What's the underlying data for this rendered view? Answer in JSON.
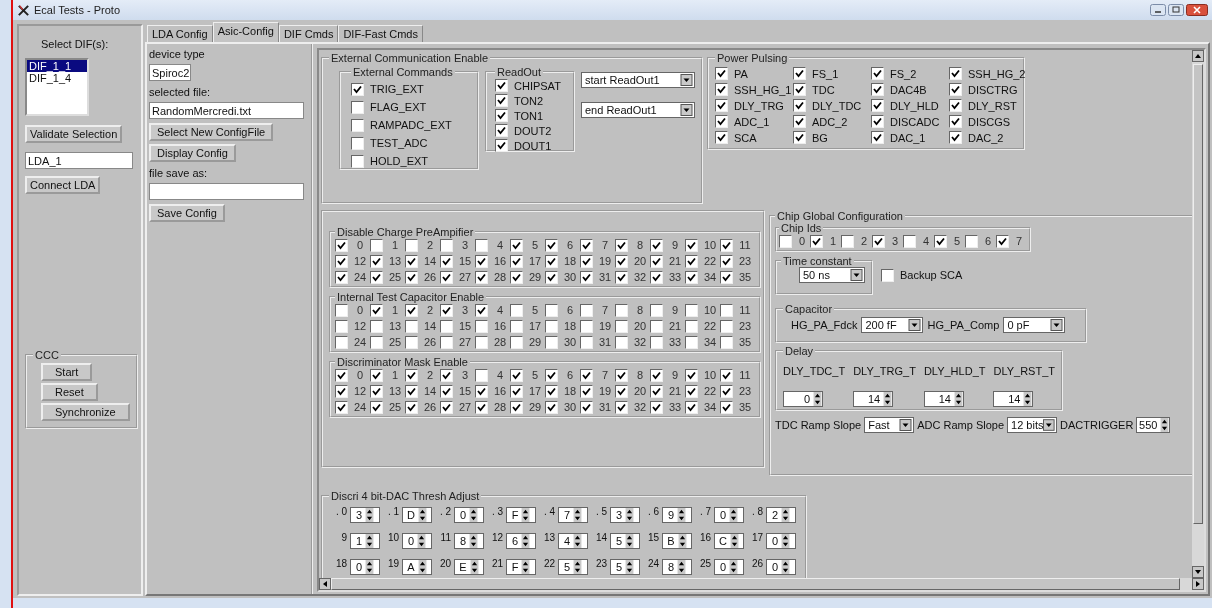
{
  "window": {
    "title": "Ecal Tests - Proto"
  },
  "dif_panel": {
    "label": "Select DIF(s):",
    "difs": [
      {
        "label": "DIF_1_1",
        "selected": true
      },
      {
        "label": "DIF_1_4",
        "selected": false
      }
    ],
    "validate_button": "Validate Selection",
    "lda_field": "LDA_1",
    "connect_button": "Connect LDA",
    "ccc": {
      "title": "CCC",
      "buttons": [
        "Start",
        "Reset",
        "Synchronize"
      ]
    }
  },
  "tabs": [
    {
      "label": "LDA Config",
      "selected": false
    },
    {
      "label": "Asic-Config",
      "selected": true
    },
    {
      "label": "DIF Cmds",
      "selected": false
    },
    {
      "label": "DIF-Fast Cmds",
      "selected": false
    }
  ],
  "config_file": {
    "device_type_label": "device type",
    "device_type": "Spiroc2",
    "selected_file_label": "selected file:",
    "selected_file": "RandomMercredi.txt",
    "select_button": "Select New ConfigFile",
    "display_button": "Display Config",
    "save_as_label": "file save as:",
    "save_button": "Save Config"
  },
  "external_communication": {
    "title": "External Communication Enable",
    "external_commands": {
      "title": "External Commands",
      "items": [
        {
          "label": "TRIG_EXT",
          "checked": true
        },
        {
          "label": "FLAG_EXT",
          "checked": false
        },
        {
          "label": "RAMPADC_EXT",
          "checked": false
        },
        {
          "label": "TEST_ADC",
          "checked": false
        },
        {
          "label": "HOLD_EXT",
          "checked": false
        }
      ]
    },
    "readout": {
      "title": "ReadOut",
      "items": [
        {
          "label": "CHIPSAT",
          "checked": true
        },
        {
          "label": "TON2",
          "checked": true
        },
        {
          "label": "TON1",
          "checked": true
        },
        {
          "label": "DOUT2",
          "checked": true
        },
        {
          "label": "DOUT1",
          "checked": true
        }
      ]
    },
    "start_select": "start ReadOut1",
    "end_select": "end ReadOut1"
  },
  "power_pulsing": {
    "title": "Power Pulsing",
    "items": [
      {
        "label": "PA",
        "checked": true
      },
      {
        "label": "FS_1",
        "checked": true
      },
      {
        "label": "FS_2",
        "checked": true
      },
      {
        "label": "SSH_HG_2",
        "checked": true
      },
      {
        "label": "SSH_HG_1",
        "checked": true
      },
      {
        "label": "TDC",
        "checked": true
      },
      {
        "label": "DAC4B",
        "checked": true
      },
      {
        "label": "DISCTRG",
        "checked": true
      },
      {
        "label": "DLY_TRG",
        "checked": true
      },
      {
        "label": "DLY_TDC",
        "checked": true
      },
      {
        "label": "DLY_HLD",
        "checked": true
      },
      {
        "label": "DLY_RST",
        "checked": true
      },
      {
        "label": "ADC_1",
        "checked": true
      },
      {
        "label": "ADC_2",
        "checked": true
      },
      {
        "label": "DISCADC",
        "checked": true
      },
      {
        "label": "DISCGS",
        "checked": true
      },
      {
        "label": "SCA",
        "checked": true
      },
      {
        "label": "BG",
        "checked": true
      },
      {
        "label": "DAC_1",
        "checked": true
      },
      {
        "label": "DAC_2",
        "checked": true
      }
    ]
  },
  "channel_groups": [
    {
      "title": "Disable Charge PreAmpifier",
      "channels": [
        {
          "label": "0",
          "checked": true
        },
        {
          "label": "1",
          "checked": false
        },
        {
          "label": "2",
          "checked": false
        },
        {
          "label": "3",
          "checked": false
        },
        {
          "label": "4",
          "checked": false
        },
        {
          "label": "5",
          "checked": true
        },
        {
          "label": "6",
          "checked": true
        },
        {
          "label": "7",
          "checked": true
        },
        {
          "label": "8",
          "checked": true
        },
        {
          "label": "9",
          "checked": true
        },
        {
          "label": "10",
          "checked": true
        },
        {
          "label": "11",
          "checked": true
        },
        {
          "label": "12",
          "checked": true
        },
        {
          "label": "13",
          "checked": true
        },
        {
          "label": "14",
          "checked": true
        },
        {
          "label": "15",
          "checked": true
        },
        {
          "label": "16",
          "checked": true
        },
        {
          "label": "17",
          "checked": true
        },
        {
          "label": "18",
          "checked": true
        },
        {
          "label": "19",
          "checked": true
        },
        {
          "label": "20",
          "checked": true
        },
        {
          "label": "21",
          "checked": true
        },
        {
          "label": "22",
          "checked": true
        },
        {
          "label": "23",
          "checked": true
        },
        {
          "label": "24",
          "checked": true
        },
        {
          "label": "25",
          "checked": true
        },
        {
          "label": "26",
          "checked": true
        },
        {
          "label": "27",
          "checked": true
        },
        {
          "label": "28",
          "checked": true
        },
        {
          "label": "29",
          "checked": true
        },
        {
          "label": "30",
          "checked": true
        },
        {
          "label": "31",
          "checked": true
        },
        {
          "label": "32",
          "checked": true
        },
        {
          "label": "33",
          "checked": true
        },
        {
          "label": "34",
          "checked": true
        },
        {
          "label": "35",
          "checked": true
        }
      ]
    },
    {
      "title": "Internal Test Capacitor Enable",
      "channels": [
        {
          "label": "0",
          "checked": false
        },
        {
          "label": "1",
          "checked": true
        },
        {
          "label": "2",
          "checked": true
        },
        {
          "label": "3",
          "checked": true
        },
        {
          "label": "4",
          "checked": true
        },
        {
          "label": "5",
          "checked": false
        },
        {
          "label": "6",
          "checked": false
        },
        {
          "label": "7",
          "checked": false
        },
        {
          "label": "8",
          "checked": false
        },
        {
          "label": "9",
          "checked": false
        },
        {
          "label": "10",
          "checked": false
        },
        {
          "label": "11",
          "checked": false
        },
        {
          "label": "12",
          "checked": false
        },
        {
          "label": "13",
          "checked": false
        },
        {
          "label": "14",
          "checked": false
        },
        {
          "label": "15",
          "checked": false
        },
        {
          "label": "16",
          "checked": false
        },
        {
          "label": "17",
          "checked": false
        },
        {
          "label": "18",
          "checked": false
        },
        {
          "label": "19",
          "checked": false
        },
        {
          "label": "20",
          "checked": false
        },
        {
          "label": "21",
          "checked": false
        },
        {
          "label": "22",
          "checked": false
        },
        {
          "label": "23",
          "checked": false
        },
        {
          "label": "24",
          "checked": false
        },
        {
          "label": "25",
          "checked": false
        },
        {
          "label": "26",
          "checked": false
        },
        {
          "label": "27",
          "checked": false
        },
        {
          "label": "28",
          "checked": false
        },
        {
          "label": "29",
          "checked": false
        },
        {
          "label": "30",
          "checked": false
        },
        {
          "label": "31",
          "checked": false
        },
        {
          "label": "32",
          "checked": false
        },
        {
          "label": "33",
          "checked": false
        },
        {
          "label": "34",
          "checked": false
        },
        {
          "label": "35",
          "checked": false
        }
      ]
    },
    {
      "title": "Discriminator Mask Enable",
      "channels": [
        {
          "label": "0",
          "checked": true
        },
        {
          "label": "1",
          "checked": true
        },
        {
          "label": "2",
          "checked": true
        },
        {
          "label": "3",
          "checked": true
        },
        {
          "label": "4",
          "checked": false
        },
        {
          "label": "5",
          "checked": true
        },
        {
          "label": "6",
          "checked": true
        },
        {
          "label": "7",
          "checked": true
        },
        {
          "label": "8",
          "checked": true
        },
        {
          "label": "9",
          "checked": true
        },
        {
          "label": "10",
          "checked": true
        },
        {
          "label": "11",
          "checked": true
        },
        {
          "label": "12",
          "checked": true
        },
        {
          "label": "13",
          "checked": true
        },
        {
          "label": "14",
          "checked": true
        },
        {
          "label": "15",
          "checked": true
        },
        {
          "label": "16",
          "checked": true
        },
        {
          "label": "17",
          "checked": true
        },
        {
          "label": "18",
          "checked": true
        },
        {
          "label": "19",
          "checked": true
        },
        {
          "label": "20",
          "checked": true
        },
        {
          "label": "21",
          "checked": true
        },
        {
          "label": "22",
          "checked": true
        },
        {
          "label": "23",
          "checked": true
        },
        {
          "label": "24",
          "checked": true
        },
        {
          "label": "25",
          "checked": true
        },
        {
          "label": "26",
          "checked": true
        },
        {
          "label": "27",
          "checked": true
        },
        {
          "label": "28",
          "checked": true
        },
        {
          "label": "29",
          "checked": true
        },
        {
          "label": "30",
          "checked": true
        },
        {
          "label": "31",
          "checked": true
        },
        {
          "label": "32",
          "checked": true
        },
        {
          "label": "33",
          "checked": true
        },
        {
          "label": "34",
          "checked": true
        },
        {
          "label": "35",
          "checked": true
        }
      ]
    }
  ],
  "chip_global": {
    "title": "Chip Global Configuration",
    "chip_ids": {
      "title": "Chip Ids",
      "items": [
        {
          "label": "0",
          "checked": false
        },
        {
          "label": "1",
          "checked": true
        },
        {
          "label": "2",
          "checked": false
        },
        {
          "label": "3",
          "checked": true
        },
        {
          "label": "4",
          "checked": false
        },
        {
          "label": "5",
          "checked": true
        },
        {
          "label": "6",
          "checked": false
        },
        {
          "label": "7",
          "checked": true
        }
      ]
    },
    "time_constant": {
      "title": "Time constant",
      "value": "50 ns"
    },
    "backup_sca": {
      "label": "Backup SCA",
      "checked": false
    },
    "capacitor": {
      "title": "Capacitor",
      "fields": [
        {
          "label": "HG_PA_Fdck",
          "value": "200 fF"
        },
        {
          "label": "HG_PA_Comp",
          "value": "0 pF"
        }
      ]
    },
    "delay": {
      "title": "Delay",
      "fields": [
        {
          "label": "DLY_TDC_T",
          "value": "0"
        },
        {
          "label": "DLY_TRG_T",
          "value": "14"
        },
        {
          "label": "DLY_HLD_T",
          "value": "14"
        },
        {
          "label": "DLY_RST_T",
          "value": "14"
        }
      ]
    },
    "settings": [
      {
        "label": "TDC Ramp Slope",
        "value": "Fast",
        "kind": "select"
      },
      {
        "label": "ADC Ramp Slope",
        "value": "12 bits",
        "kind": "select"
      },
      {
        "label": "DACTRIGGER",
        "value": "550",
        "kind": "spin"
      }
    ]
  },
  "dac_thresholds": {
    "title": "Discri 4 bit-DAC Thresh Adjust",
    "rows": [
      [
        {
          "label": ". 0",
          "value": "3"
        },
        {
          "label": ". 1",
          "value": "D"
        },
        {
          "label": ". 2",
          "value": "0"
        },
        {
          "label": ". 3",
          "value": "F"
        },
        {
          "label": ". 4",
          "value": "7"
        },
        {
          "label": ". 5",
          "value": "3"
        },
        {
          "label": ". 6",
          "value": "9"
        },
        {
          "label": ". 7",
          "value": "0"
        },
        {
          "label": ". 8",
          "value": "2"
        }
      ],
      [
        {
          "label": "9",
          "value": "1"
        },
        {
          "label": "10",
          "value": "0"
        },
        {
          "label": "11",
          "value": "8"
        },
        {
          "label": "12",
          "value": "6"
        },
        {
          "label": "13",
          "value": "4"
        },
        {
          "label": "14",
          "value": "5"
        },
        {
          "label": "15",
          "value": "B"
        },
        {
          "label": "16",
          "value": "C"
        },
        {
          "label": "17",
          "value": "0"
        }
      ],
      [
        {
          "label": "18",
          "value": "0"
        },
        {
          "label": "19",
          "value": "A"
        },
        {
          "label": "20",
          "value": "E"
        },
        {
          "label": "21",
          "value": "F"
        },
        {
          "label": "22",
          "value": "5"
        },
        {
          "label": "23",
          "value": "5"
        },
        {
          "label": "24",
          "value": "8"
        },
        {
          "label": "25",
          "value": "0"
        },
        {
          "label": "26",
          "value": "0"
        }
      ]
    ]
  }
}
